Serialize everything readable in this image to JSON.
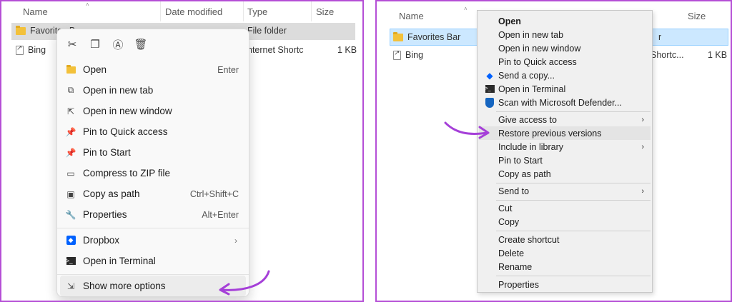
{
  "headers": {
    "name": "Name",
    "date_modified": "Date modified",
    "type": "Type",
    "size": "Size"
  },
  "left_files": [
    {
      "name": "Favorites B",
      "type": "File folder",
      "size": ""
    },
    {
      "name": "Bing",
      "type": "nternet Shortc",
      "size": "1 KB"
    }
  ],
  "right_files": [
    {
      "name": "Favorites Bar",
      "type": "r",
      "size": ""
    },
    {
      "name": "Bing",
      "type": "Shortc...",
      "size": "1 KB"
    }
  ],
  "quick_actions": [
    {
      "icon": "cut-icon"
    },
    {
      "icon": "copy-icon"
    },
    {
      "icon": "rename-icon"
    },
    {
      "icon": "delete-icon"
    }
  ],
  "modern_menu": {
    "items": [
      {
        "label": "Open",
        "shortcut": "Enter",
        "icon": "folder-open-icon"
      },
      {
        "label": "Open in new tab",
        "shortcut": "",
        "icon": "new-tab-icon"
      },
      {
        "label": "Open in new window",
        "shortcut": "",
        "icon": "new-window-icon"
      },
      {
        "label": "Pin to Quick access",
        "shortcut": "",
        "icon": "pin-icon"
      },
      {
        "label": "Pin to Start",
        "shortcut": "",
        "icon": "pin-icon"
      },
      {
        "label": "Compress to ZIP file",
        "shortcut": "",
        "icon": "zip-icon"
      },
      {
        "label": "Copy as path",
        "shortcut": "Ctrl+Shift+C",
        "icon": "copy-path-icon"
      },
      {
        "label": "Properties",
        "shortcut": "Alt+Enter",
        "icon": "wrench-icon"
      },
      {
        "label": "Dropbox",
        "shortcut": "",
        "icon": "dropbox-icon"
      },
      {
        "label": "Open in Terminal",
        "shortcut": "",
        "icon": "terminal-icon"
      },
      {
        "label": "Show more options",
        "shortcut": "",
        "icon": "more-options-icon"
      }
    ]
  },
  "classic_menu": {
    "items": [
      {
        "label": "Open"
      },
      {
        "label": "Open in new tab"
      },
      {
        "label": "Open in new window"
      },
      {
        "label": "Pin to Quick access"
      },
      {
        "label": "Send a copy..."
      },
      {
        "label": "Open in Terminal"
      },
      {
        "label": "Scan with Microsoft Defender..."
      },
      {
        "label": "Give access to"
      },
      {
        "label": "Restore previous versions"
      },
      {
        "label": "Include in library"
      },
      {
        "label": "Pin to Start"
      },
      {
        "label": "Copy as path"
      },
      {
        "label": "Send to"
      },
      {
        "label": "Cut"
      },
      {
        "label": "Copy"
      },
      {
        "label": "Create shortcut"
      },
      {
        "label": "Delete"
      },
      {
        "label": "Rename"
      },
      {
        "label": "Properties"
      }
    ]
  },
  "colors": {
    "frame_border": "#b54fd6",
    "arrow": "#a53fd8",
    "selection_gray": "#dcdcdc",
    "selection_blue": "#cce8ff"
  }
}
